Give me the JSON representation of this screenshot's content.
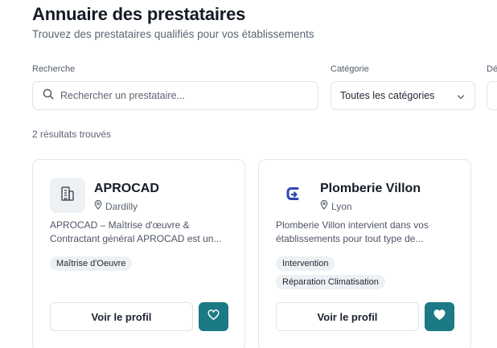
{
  "header": {
    "title": "Annuaire des prestataires",
    "subtitle": "Trouvez des prestataires qualifiés pour vos établissements"
  },
  "filters": {
    "search_label": "Recherche",
    "search_placeholder": "Rechercher un prestataire...",
    "category_label": "Catégorie",
    "category_value": "Toutes les catégories",
    "third_label": "Dé"
  },
  "results": {
    "count_text": "2 résultats trouvés"
  },
  "cards": [
    {
      "name": "APROCAD",
      "location": "Dardilly",
      "description": "APROCAD – Maîtrise d'œuvre & Contractant général APROCAD est un...",
      "tags": [
        "Maîtrise d'Oeuvre"
      ],
      "profile_button": "Voir le profil",
      "favorite": false,
      "logo_icon": "building-icon"
    },
    {
      "name": "Plomberie Villon",
      "location": "Lyon",
      "description": "Plomberie Villon intervient dans vos établissements pour tout type de...",
      "tags": [
        "Intervention",
        "Réparation Climatisation"
      ],
      "profile_button": "Voir le profil",
      "favorite": true,
      "logo_icon": "plomberie-logo-icon"
    }
  ],
  "colors": {
    "accent": "#1b7a85",
    "logo_blue": "#2c46b5"
  }
}
